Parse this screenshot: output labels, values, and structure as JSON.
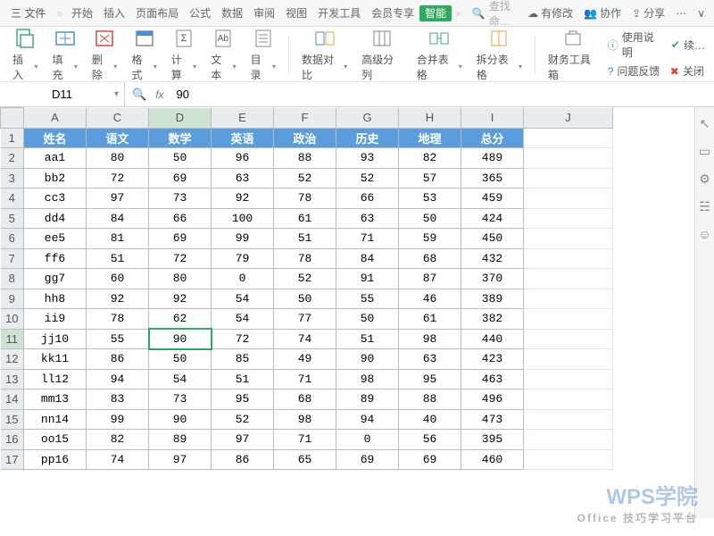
{
  "menu": {
    "file": "三 文件",
    "sep": "»",
    "tabs": [
      "开始",
      "插入",
      "页面布局",
      "公式",
      "数据",
      "审阅",
      "视图",
      "开发工具",
      "会员专享",
      "智能"
    ],
    "active_index": 9,
    "search_icon": "🔍",
    "search_placeholder": "查找命…",
    "right": {
      "unsaved": "有修改",
      "coop": "协作",
      "share": "分享"
    }
  },
  "ribbon": {
    "items": [
      {
        "label": "插入",
        "dd": true
      },
      {
        "label": "填充",
        "dd": true
      },
      {
        "label": "删除",
        "dd": true
      },
      {
        "label": "格式",
        "dd": true
      },
      {
        "label": "计算",
        "dd": true
      },
      {
        "label": "文本",
        "dd": true
      },
      {
        "label": "目录",
        "dd": true
      },
      {
        "label": "数据对比",
        "dd": true
      },
      {
        "label": "高级分列",
        "dd": false
      },
      {
        "label": "合并表格",
        "dd": true
      },
      {
        "label": "拆分表格",
        "dd": true
      },
      {
        "label": "财务工具箱",
        "dd": false
      }
    ],
    "right": {
      "help": "使用说明",
      "cont": "续…",
      "feedback": "问题反馈",
      "close": "关闭"
    }
  },
  "name_box": "D11",
  "fx_label": "fx",
  "formula": "90",
  "cols": [
    "A",
    "C",
    "D",
    "E",
    "F",
    "G",
    "H",
    "I",
    "J"
  ],
  "sel_col_index": 2,
  "sel_row": 11,
  "header_row": [
    "姓名",
    "语文",
    "数学",
    "英语",
    "政治",
    "历史",
    "地理",
    "总分"
  ],
  "rows": [
    {
      "n": 2,
      "c": [
        "aa1",
        "80",
        "50",
        "96",
        "88",
        "93",
        "82",
        "489"
      ]
    },
    {
      "n": 3,
      "c": [
        "bb2",
        "72",
        "69",
        "63",
        "52",
        "52",
        "57",
        "365"
      ]
    },
    {
      "n": 4,
      "c": [
        "cc3",
        "97",
        "73",
        "92",
        "78",
        "66",
        "53",
        "459"
      ]
    },
    {
      "n": 5,
      "c": [
        "dd4",
        "84",
        "66",
        "100",
        "61",
        "63",
        "50",
        "424"
      ]
    },
    {
      "n": 6,
      "c": [
        "ee5",
        "81",
        "69",
        "99",
        "51",
        "71",
        "59",
        "450"
      ]
    },
    {
      "n": 7,
      "c": [
        "ff6",
        "51",
        "72",
        "79",
        "78",
        "84",
        "68",
        "432"
      ]
    },
    {
      "n": 8,
      "c": [
        "gg7",
        "60",
        "80",
        "0",
        "52",
        "91",
        "87",
        "370"
      ]
    },
    {
      "n": 9,
      "c": [
        "hh8",
        "92",
        "92",
        "54",
        "50",
        "55",
        "46",
        "389"
      ]
    },
    {
      "n": 10,
      "c": [
        "ii9",
        "78",
        "62",
        "54",
        "77",
        "50",
        "61",
        "382"
      ]
    },
    {
      "n": 11,
      "c": [
        "jj10",
        "55",
        "90",
        "72",
        "74",
        "51",
        "98",
        "440"
      ]
    },
    {
      "n": 12,
      "c": [
        "kk11",
        "86",
        "50",
        "85",
        "49",
        "90",
        "63",
        "423"
      ]
    },
    {
      "n": 13,
      "c": [
        "ll12",
        "94",
        "54",
        "51",
        "71",
        "98",
        "95",
        "463"
      ]
    },
    {
      "n": 14,
      "c": [
        "mm13",
        "83",
        "73",
        "95",
        "68",
        "89",
        "88",
        "496"
      ]
    },
    {
      "n": 15,
      "c": [
        "nn14",
        "99",
        "90",
        "52",
        "98",
        "94",
        "40",
        "473"
      ]
    },
    {
      "n": 16,
      "c": [
        "oo15",
        "82",
        "89",
        "97",
        "71",
        "0",
        "56",
        "395"
      ]
    },
    {
      "n": 17,
      "c": [
        "pp16",
        "74",
        "97",
        "86",
        "65",
        "69",
        "69",
        "460"
      ]
    }
  ],
  "watermark": {
    "title": "WPS学院",
    "sub": "Office 技巧学习平台"
  }
}
